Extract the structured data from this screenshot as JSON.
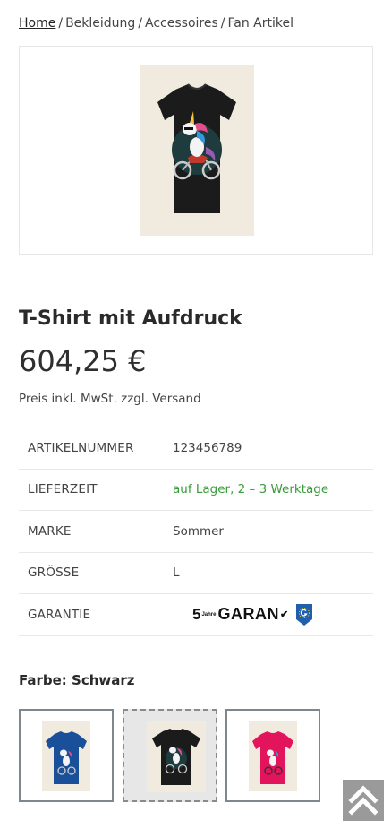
{
  "breadcrumb": {
    "home": "Home",
    "separator": "/",
    "items": [
      "Bekleidung",
      "Accessoires",
      "Fan Artikel"
    ]
  },
  "product": {
    "title": "T-Shirt mit Aufdruck",
    "price": "604,25 €",
    "tax_note": "Preis inkl. MwSt. zzgl. Versand",
    "main_image_icon": "t-shirt-unicorn-motorcycle-image"
  },
  "attributes": [
    {
      "key": "Artikelnummer",
      "value": "123456789"
    },
    {
      "key": "Lieferzeit",
      "value": "auf Lager, 2 – 3 Werktage"
    },
    {
      "key": "Marke",
      "value": "Sommer"
    },
    {
      "key": "Größe",
      "value": "L"
    },
    {
      "key": "Garantie",
      "value": ""
    }
  ],
  "guarantee_logo": {
    "number": "5",
    "superscript": "Jahre",
    "text": "GARAN"
  },
  "color": {
    "label": "Farbe: Schwarz",
    "swatches": [
      {
        "name": "Blau",
        "shirt_color": "#1a4f9a",
        "selected": false
      },
      {
        "name": "Schwarz",
        "shirt_color": "#1b1b1b",
        "selected": true
      },
      {
        "name": "Pink",
        "shirt_color": "#e2145c",
        "selected": false
      }
    ]
  },
  "colors": {
    "in_stock_green": "#3a9b3a",
    "text": "#333333",
    "border": "#e8e8e8",
    "back_to_top_bg": "#9a9a9a"
  },
  "icons": {
    "back_to_top": "double-chevron-up-icon",
    "eu_badge": "eu-guarantee-badge-icon"
  }
}
